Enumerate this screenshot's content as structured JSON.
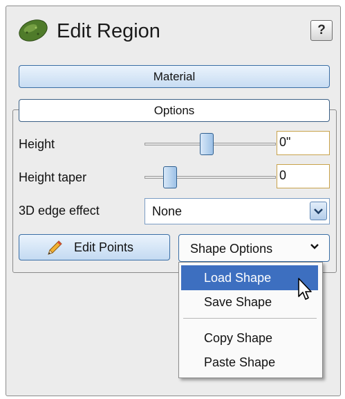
{
  "header": {
    "title": "Edit Region",
    "help_label": "?",
    "icon": "region-leaf-icon"
  },
  "sections": {
    "material_label": "Material",
    "options_label": "Options"
  },
  "options": {
    "height": {
      "label": "Height",
      "value": "0\"",
      "slider_fraction": 0.47
    },
    "height_taper": {
      "label": "Height taper",
      "value": "0",
      "slider_fraction": 0.16
    },
    "edge_effect": {
      "label": "3D edge effect",
      "selected": "None"
    }
  },
  "buttons": {
    "edit_points": "Edit Points",
    "shape_options": "Shape Options"
  },
  "shape_menu": {
    "items": [
      "Load Shape",
      "Save Shape",
      "Copy Shape",
      "Paste Shape"
    ],
    "highlighted": "Load Shape"
  },
  "colors": {
    "accent_blue": "#3d6fc0",
    "bar_border": "#3a6ea5",
    "field_border": "#c8a24a",
    "panel_bg": "#ececec"
  }
}
